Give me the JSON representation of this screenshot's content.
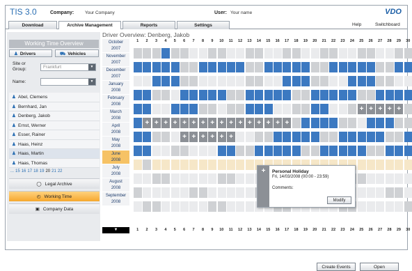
{
  "header": {
    "app_title": "TIS 3.0",
    "company_label": "Company:",
    "company_value": "Your Company",
    "user_label": "User:",
    "user_value": "Your name",
    "brand": "VDO"
  },
  "menu": {
    "tabs": [
      "Download",
      "Archive Management",
      "Reports",
      "Settings"
    ],
    "active_tab": "Archive Management",
    "help": "Help",
    "switchboard": "Switchboard"
  },
  "sidebar": {
    "panel_title": "Working Time Overview",
    "tab_drivers": "Drivers",
    "tab_vehicles": "Vehicles",
    "site_label": "Site or\nGroup:",
    "site_value": "Frankfurt",
    "name_label": "Name:",
    "name_value": "",
    "drivers": [
      "Abel, Clemens",
      "Bernhard, Jan",
      "Denberg, Jakob",
      "Ernst, Werner",
      "Esser, Rainer",
      "Haas, Heinz",
      "Haas, Martin",
      "Haas, Thomas"
    ],
    "selected_driver": "Haas, Martin",
    "pager_prefix": "...",
    "pages": [
      "15",
      "16",
      "17",
      "18",
      "19",
      "20",
      "21",
      "22"
    ],
    "current_page": "20",
    "nav": [
      {
        "label": "Legal Archive",
        "icon": "shield-icon"
      },
      {
        "label": "Working Time",
        "icon": "clock-icon"
      },
      {
        "label": "Company Data",
        "icon": "building-icon"
      }
    ],
    "active_nav": "Working Time"
  },
  "main": {
    "title": "Driver Overview: Denberg, Jakob",
    "months": [
      {
        "m": "October",
        "y": "2007"
      },
      {
        "m": "November",
        "y": "2007"
      },
      {
        "m": "December",
        "y": "2007"
      },
      {
        "m": "January",
        "y": "2008"
      },
      {
        "m": "February",
        "y": "2008"
      },
      {
        "m": "March",
        "y": "2008"
      },
      {
        "m": "April",
        "y": "2008"
      },
      {
        "m": "May",
        "y": "2008"
      },
      {
        "m": "June",
        "y": "2008"
      },
      {
        "m": "July",
        "y": "2008"
      },
      {
        "m": "August",
        "y": "2008"
      },
      {
        "m": "September",
        "y": "2008"
      }
    ],
    "highlighted_month": "June",
    "days": [
      "1",
      "2",
      "3",
      "4",
      "5",
      "6",
      "7",
      "8",
      "9",
      "10",
      "11",
      "12",
      "13",
      "14",
      "15",
      "16",
      "17",
      "18",
      "19",
      "20",
      "21",
      "22",
      "23",
      "24",
      "25",
      "26",
      "27",
      "28",
      "29",
      "30",
      "31"
    ],
    "legend_colors": {
      "work": "#3c79c1",
      "weekend": "#cfd1d4",
      "empty": "#eaebed",
      "holiday": "#8c9096",
      "planned": "#f6e7c8"
    },
    "rows": [
      "gggwgg..gg..gg..gg..gg..gg..ggw",
      "wwwwwggwwwwwggwwwwwggwwwwwggwww",
      "..wwwgg.....gg..wwwgg..wwwgg...",
      "wwgg.wwwwwggwwwwwggwwwwwggwwwww",
      "ww..wwwgg.ggwww..ggww..gHHHHHgg",
      "wHHHHHHHHHHHHHHHHgwwwwgg.wwwggw",
      "wwgg.HHHHHH..ggwwwwwggwwwwwggww",
      "ww..gg...wwggwwwwwggwwwwwggwww.",
      "pgppppppppppppppppppppppppppppp",
      "..gg.....gg.....gg.....gg.....g",
      "g.....gg.....gg.....gg.....gg..",
      ".gg.....gg.....gg.....gg.....gg"
    ],
    "popup": {
      "title": "Personal Holiday",
      "date": "Fri, 14/03/2008 (00:00 - 23:59)",
      "comments_label": "Comments:",
      "button": "Modify"
    },
    "create_button": "Create Events",
    "open_button": "Open"
  }
}
